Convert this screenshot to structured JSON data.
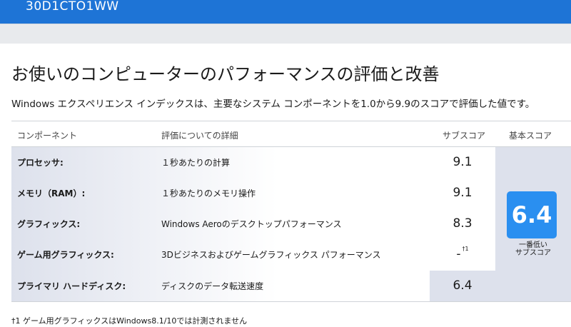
{
  "window": {
    "machine_id": "30D1CTO1WW"
  },
  "page": {
    "heading": "お使いのコンピューターのパフォーマンスの評価と改善",
    "description": "Windows エクスペリエンス インデックスは、主要なシステム コンポーネントを1.0から9.9のスコアで評価した値です。"
  },
  "table": {
    "headers": {
      "component": "コンポーネント",
      "detail": "評価についての詳細",
      "subscore": "サブスコア",
      "basescore": "基本スコア"
    },
    "rows": [
      {
        "component": "プロセッサ:",
        "detail": "１秒あたりの計算",
        "subscore": "9.1",
        "footnote_mark": ""
      },
      {
        "component": "メモリ（RAM）:",
        "detail": "１秒あたりのメモリ操作",
        "subscore": "9.1",
        "footnote_mark": ""
      },
      {
        "component": "グラフィックス:",
        "detail": "Windows Aeroのデスクトップパフォーマンス",
        "subscore": "8.3",
        "footnote_mark": ""
      },
      {
        "component": "ゲーム用グラフィックス:",
        "detail": "3Dビジネスおよびゲームグラフィックス パフォーマンス",
        "subscore": "-",
        "footnote_mark": "†1"
      },
      {
        "component": "プライマリ ハードディスク:",
        "detail": "ディスクのデータ転送速度",
        "subscore": "6.4",
        "footnote_mark": ""
      }
    ],
    "base_score": {
      "value": "6.4",
      "caption_line1": "一番低い",
      "caption_line2": "サブスコア"
    }
  },
  "footnote": "†1 ゲーム用グラフィックスはWindows8.1/10では計測されません",
  "colors": {
    "title_bar": "#1e74d6",
    "base_tile": "#2a8ff0",
    "row_tint": "#dde1ec"
  }
}
